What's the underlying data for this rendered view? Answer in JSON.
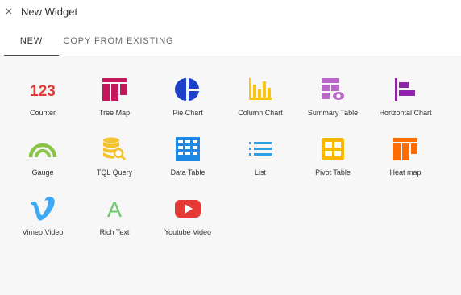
{
  "dialog": {
    "title": "New Widget",
    "close_icon": "close-icon"
  },
  "tabs": [
    {
      "label": "NEW",
      "active": true
    },
    {
      "label": "COPY FROM EXISTING",
      "active": false
    }
  ],
  "colors": {
    "counter": "#e53935",
    "tree_map": "#c2185b",
    "pie": "#1e40c8",
    "column": "#f9c60c",
    "summary": "#ba68c8",
    "horizontal": "#8e24aa",
    "gauge": "#8bc34a",
    "tql": "#f2c230",
    "data_table": "#1e88e5",
    "list": "#29a3e6",
    "pivot": "#fbb600",
    "heat": "#ff6d00",
    "vimeo": "#3fa9f5",
    "rich_text": "#6ac96e",
    "youtube": "#e53935"
  },
  "widgets": [
    {
      "label": "Counter",
      "icon": "counter-icon",
      "glyph": "123"
    },
    {
      "label": "Tree Map",
      "icon": "tree-map-icon"
    },
    {
      "label": "Pie Chart",
      "icon": "pie-chart-icon"
    },
    {
      "label": "Column Chart",
      "icon": "column-chart-icon"
    },
    {
      "label": "Summary Table",
      "icon": "summary-table-icon"
    },
    {
      "label": "Horizontal Chart",
      "icon": "horizontal-chart-icon"
    },
    {
      "label": "Gauge",
      "icon": "gauge-icon"
    },
    {
      "label": "TQL Query",
      "icon": "tql-query-icon"
    },
    {
      "label": "Data Table",
      "icon": "data-table-icon"
    },
    {
      "label": "List",
      "icon": "list-icon"
    },
    {
      "label": "Pivot Table",
      "icon": "pivot-table-icon"
    },
    {
      "label": "Heat map",
      "icon": "heat-map-icon"
    },
    {
      "label": "Vimeo Video",
      "icon": "vimeo-icon"
    },
    {
      "label": "Rich Text",
      "icon": "rich-text-icon",
      "glyph": "A"
    },
    {
      "label": "Youtube Video",
      "icon": "youtube-icon"
    }
  ]
}
